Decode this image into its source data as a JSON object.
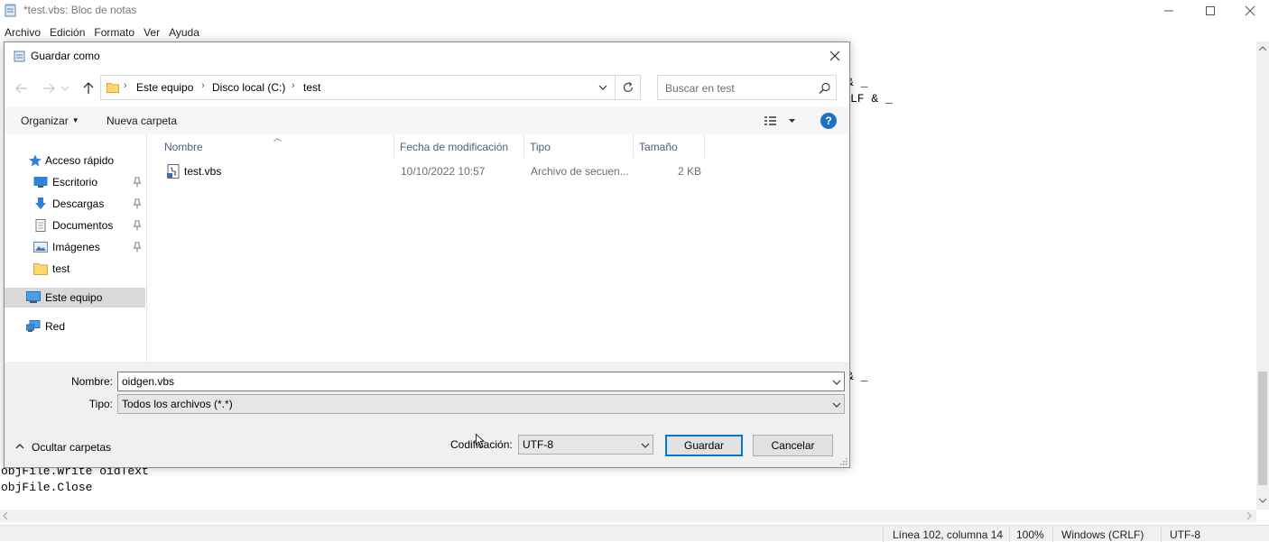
{
  "notepad": {
    "title": "*test.vbs: Bloc de notas",
    "menu": [
      "Archivo",
      "Edición",
      "Formato",
      "Ver",
      "Ayuda"
    ],
    "visible_code": {
      "frag1": "& _",
      "frag2": "LF & _",
      "frag3": "& _",
      "line_write": "objFile.Write oidText",
      "line_close": "objFile.Close"
    },
    "status": {
      "position": "Línea 102, columna 14",
      "zoom": "100%",
      "line_endings": "Windows (CRLF)",
      "encoding": "UTF-8"
    }
  },
  "dialog": {
    "title": "Guardar como",
    "breadcrumb": [
      "Este equipo",
      "Disco local (C:)",
      "test"
    ],
    "search_placeholder": "Buscar en test",
    "toolbar": {
      "organize": "Organizar",
      "new_folder": "Nueva carpeta",
      "help": "?"
    },
    "nav": {
      "quick_access": "Acceso rápido",
      "items": [
        "Escritorio",
        "Descargas",
        "Documentos",
        "Imágenes",
        "test"
      ],
      "this_pc": "Este equipo",
      "network": "Red"
    },
    "columns": [
      "Nombre",
      "Fecha de modificación",
      "Tipo",
      "Tamaño"
    ],
    "files": [
      {
        "name": "test.vbs",
        "modified": "10/10/2022 10:57",
        "type": "Archivo de secuen...",
        "size": "2 KB"
      }
    ],
    "form": {
      "name_label": "Nombre:",
      "name_value": "oidgen.vbs",
      "type_label": "Tipo:",
      "type_value": "Todos los archivos  (*.*)",
      "hide_folders": "Ocultar carpetas",
      "encoding_label": "Codificación:",
      "encoding_value": "UTF-8",
      "save": "Guardar",
      "cancel": "Cancelar"
    }
  }
}
